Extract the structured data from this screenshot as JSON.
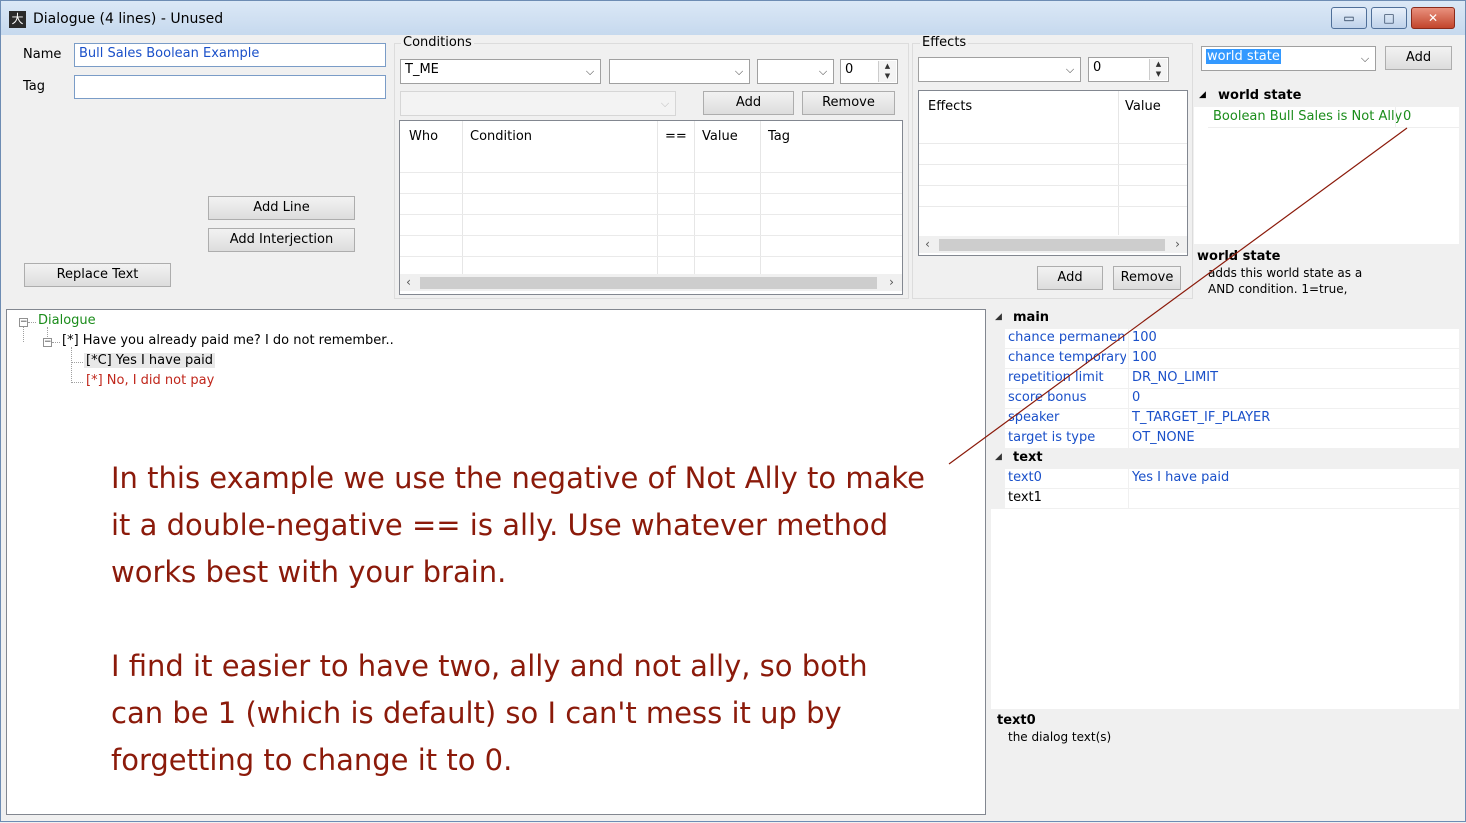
{
  "window": {
    "title": "Dialogue (4 lines) - Unused",
    "minimize": "▭",
    "maximize": "□",
    "close": "✕"
  },
  "line_editor": {
    "name_label": "Name",
    "name_value": "Bull Sales Boolean Example",
    "tag_label": "Tag",
    "tag_value": "",
    "add_line": "Add Line",
    "add_interjection": "Add Interjection",
    "replace_text": "Replace Text"
  },
  "conditions": {
    "title": "Conditions",
    "who_value": "T_ME",
    "condition_value": "",
    "op_value": "",
    "value_value": "0",
    "add": "Add",
    "remove": "Remove",
    "columns": [
      "Who",
      "Condition",
      "==",
      "Value",
      "Tag"
    ]
  },
  "effects": {
    "title": "Effects",
    "effect_value": "",
    "value_value": "0",
    "columns": [
      "Effects",
      "Value"
    ],
    "add": "Add",
    "remove": "Remove"
  },
  "world_state": {
    "select_value": "world state",
    "add": "Add",
    "category": "world state",
    "item_name": "Boolean Bull Sales is Not Ally",
    "item_value": "0",
    "desc_title": "world state",
    "desc_line1": "adds this world state as a",
    "desc_line2": "AND condition.  1=true,"
  },
  "tree": {
    "root": "Dialogue",
    "line1": "[*] Have you already paid me? I do not remember..",
    "resp1": "[*C] Yes I have paid",
    "resp2": "[*] No, I did not pay",
    "colors": {
      "root": "#1a8c1a",
      "resp2": "#c0261b"
    }
  },
  "note": {
    "p1_l1": "In this example we use the negative of Not Ally to make",
    "p1_l2": "it a double-negative == is ally. Use whatever method",
    "p1_l3": "works best with your brain.",
    "p2_l1": "I find it easier to have two, ally and not ally, so both",
    "p2_l2": "can be 1 (which is default) so I can't mess it up by",
    "p2_l3": "forgetting to change it to 0.",
    "color": "#8b1a0a"
  },
  "properties": {
    "cat_main": "main",
    "main": [
      {
        "name": "chance permanent",
        "value": "100"
      },
      {
        "name": "chance temporary",
        "value": "100"
      },
      {
        "name": "repetition limit",
        "value": "DR_NO_LIMIT"
      },
      {
        "name": "score bonus",
        "value": "0"
      },
      {
        "name": "speaker",
        "value": "T_TARGET_IF_PLAYER"
      },
      {
        "name": "target is type",
        "value": "OT_NONE"
      }
    ],
    "cat_text": "text",
    "text": [
      {
        "name": "text0",
        "value": "Yes I have paid"
      },
      {
        "name": "text1",
        "value": ""
      }
    ],
    "desc_title": "text0",
    "desc_body": "the dialog text(s)"
  }
}
